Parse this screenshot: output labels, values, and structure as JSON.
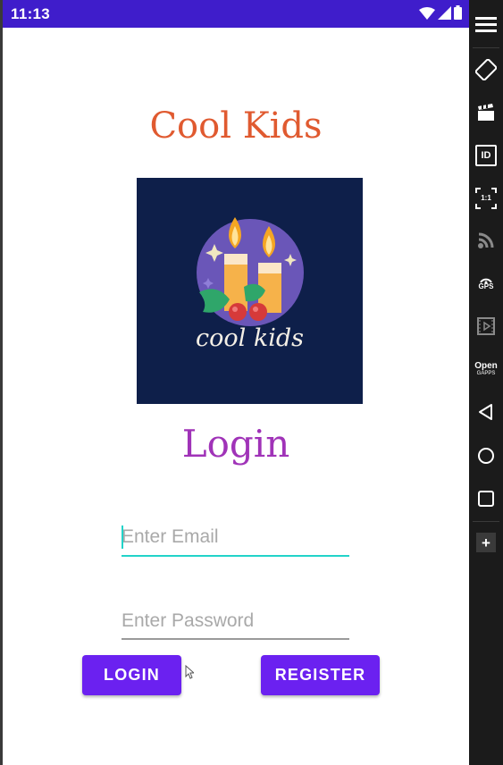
{
  "status_bar": {
    "time": "11:13",
    "icons": [
      "wifi-icon",
      "cellular-signal-icon",
      "battery-icon"
    ],
    "background": "#3f1dcb"
  },
  "app": {
    "title": "Cool Kids",
    "title_color": "#e05a30",
    "logo": {
      "text": "cool kids",
      "background": "#0e1f4a"
    },
    "login_heading": "Login",
    "login_heading_color": "#a033b8",
    "email_placeholder": "Enter Email",
    "password_placeholder": "Enter Password",
    "focus_color": "#22d3c9",
    "buttons": {
      "login": "LOGIN",
      "register": "REGISTER",
      "color": "#6b21f0"
    }
  },
  "emulator_toolbar": {
    "items": [
      "menu-icon",
      "rotate-icon",
      "screen-record-icon",
      "device-id-icon",
      "pixel-perfect-icon",
      "rss-icon",
      "gps-icon",
      "media-icon",
      "open-gapps-icon",
      "back-icon",
      "home-icon",
      "recents-icon",
      "add-icon"
    ],
    "pixel_label": "1:1",
    "id_label": "ID",
    "gps_label": "GPS",
    "opengapps_line1": "Open",
    "opengapps_line2": "GAPPS",
    "add_label": "+"
  }
}
